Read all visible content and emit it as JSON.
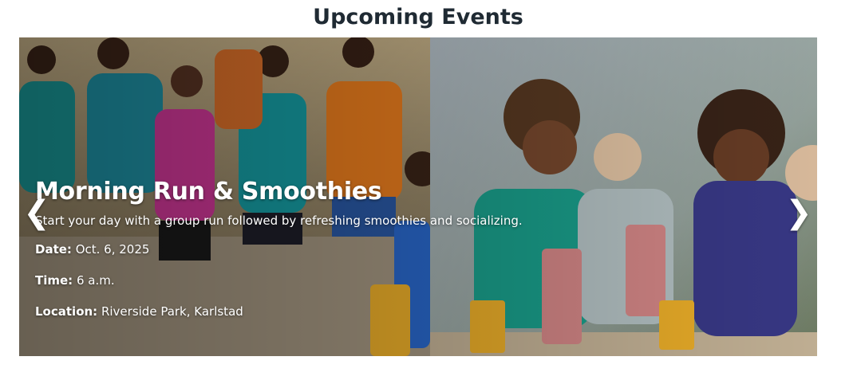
{
  "section": {
    "title": "Upcoming Events"
  },
  "carousel": {
    "prev_icon": "❮",
    "next_icon": "❯",
    "slide": {
      "image": "runners-and-smoothies-photo",
      "title": "Morning Run & Smoothies",
      "description": "Start your day with a group run followed by refreshing smoothies and socializing.",
      "date_label": "Date:",
      "date_value": "Oct. 6, 2025",
      "time_label": "Time:",
      "time_value": "6 a.m.",
      "location_label": "Location:",
      "location_value": "Riverside Park, Karlstad"
    }
  },
  "colors": {
    "title": "#1f2a33",
    "caption_text": "#ffffff"
  }
}
